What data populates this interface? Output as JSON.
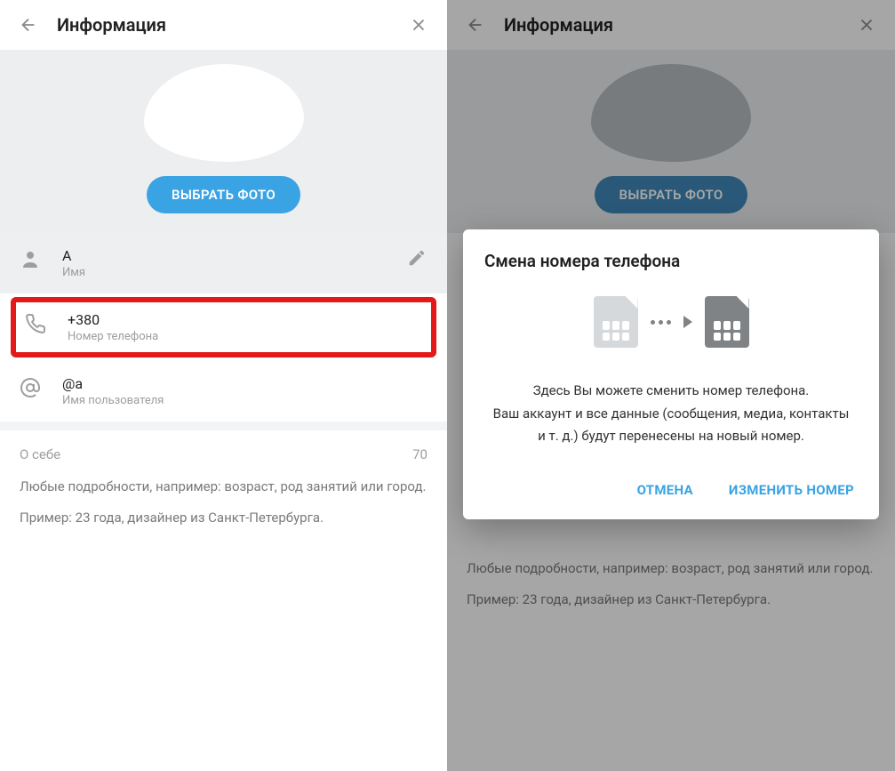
{
  "left": {
    "header": {
      "title": "Информация"
    },
    "photo": {
      "button": "ВЫБРАТЬ ФОТО"
    },
    "name": {
      "value": "А",
      "label": "Имя"
    },
    "phone": {
      "value": "+380",
      "label": "Номер телефона"
    },
    "username": {
      "value": "@a",
      "label": "Имя пользователя"
    },
    "about": {
      "head": "О себе",
      "counter": "70",
      "desc1": "Любые подробности, например: возраст, род занятий или город.",
      "desc2": "Пример: 23 года, дизайнер из Санкт-Петербурга."
    }
  },
  "right": {
    "header": {
      "title": "Информация"
    },
    "photo": {
      "button": "ВЫБРАТЬ ФОТО"
    },
    "about": {
      "desc1": "Любые подробности, например: возраст, род занятий или город.",
      "desc2": "Пример: 23 года, дизайнер из Санкт-Петербурга."
    },
    "modal": {
      "title": "Смена номера телефона",
      "body1": "Здесь Вы можете сменить номер телефона.",
      "body2": "Ваш аккаунт и все данные (сообщения, медиа, контакты",
      "body3": "и т. д.) будут перенесены на новый номер.",
      "cancel": "ОТМЕНА",
      "confirm": "ИЗМЕНИТЬ НОМЕР"
    }
  }
}
